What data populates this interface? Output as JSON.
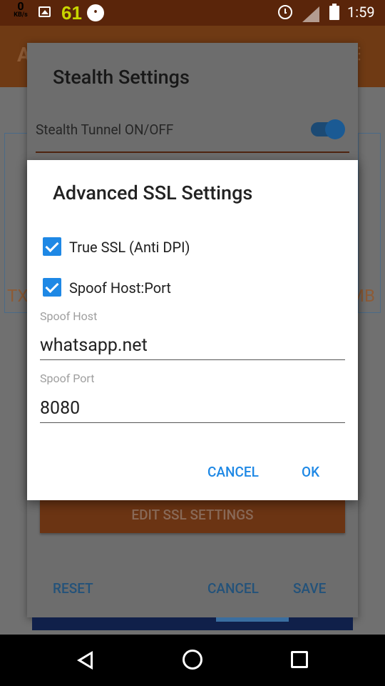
{
  "status_bar": {
    "net_speed_value": "0",
    "net_speed_unit": "KB/s",
    "notification_count": "61",
    "time": "1:59"
  },
  "background_app": {
    "title_initial": "A",
    "left_edge_text": "TX",
    "right_edge_text": "MB"
  },
  "stealth_dialog": {
    "title": "Stealth Settings",
    "tunnel_label": "Stealth Tunnel ON/OFF",
    "tunnel_enabled": true,
    "edit_ssl_button": "EDIT SSL SETTINGS",
    "reset_button": "RESET",
    "cancel_button": "CANCEL",
    "save_button": "SAVE"
  },
  "ssl_dialog": {
    "title": "Advanced SSL Settings",
    "true_ssl": {
      "label": "True SSL (Anti DPI)",
      "checked": true
    },
    "spoof_host_port": {
      "label": "Spoof Host:Port",
      "checked": true
    },
    "spoof_host": {
      "label": "Spoof Host",
      "value": "whatsapp.net"
    },
    "spoof_port": {
      "label": "Spoof Port",
      "value": "8080"
    },
    "cancel_button": "CANCEL",
    "ok_button": "OK"
  },
  "colors": {
    "accent": "#1e88e5",
    "app_bar": "#e06a1e",
    "status_bar": "#b44a14"
  }
}
